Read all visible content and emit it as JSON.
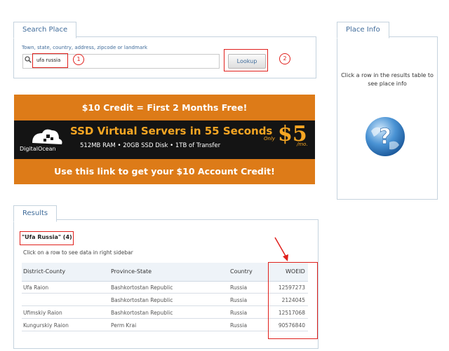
{
  "search": {
    "tab_label": "Search Place",
    "hint": "Town, state, country, address, zipcode or landmark",
    "value": "ufa  russia",
    "button_label": "Lookup",
    "annotation_1": "1",
    "annotation_2": "2"
  },
  "place_info": {
    "tab_label": "Place Info",
    "message": "Click a row in the results table to see place info"
  },
  "banner": {
    "top_text": "$10 Credit = First 2 Months Free!",
    "brand": "DigitalOcean",
    "headline": "SSD Virtual Servers in 55 Seconds",
    "specs": "512MB RAM  •  20GB SSD Disk  •  1TB of Transfer",
    "only": "Only",
    "price": "$5",
    "per": "/mo.",
    "bottom_text": "Use this link to get your $10 Account Credit!"
  },
  "results": {
    "tab_label": "Results",
    "query": "\"Ufa Russia\" (4)",
    "hint": "Click on a row to see data in right sidebar",
    "columns": [
      "District-County",
      "Province-State",
      "Country",
      "WOEID"
    ],
    "rows": [
      {
        "district": "Ufa Raion",
        "province": "Bashkortostan Republic",
        "country": "Russia",
        "woeid": "12597273"
      },
      {
        "district": "",
        "province": "Bashkortostan Republic",
        "country": "Russia",
        "woeid": "2124045"
      },
      {
        "district": "Ufimskiy Raion",
        "province": "Bashkortostan Republic",
        "country": "Russia",
        "woeid": "12517068"
      },
      {
        "district": "Kungurskiy Raion",
        "province": "Perm Krai",
        "country": "Russia",
        "woeid": "90576840"
      }
    ]
  },
  "colors": {
    "annotation": "#e0201c",
    "banner_orange": "#dd7b18",
    "link_blue": "#3f6b9a"
  }
}
